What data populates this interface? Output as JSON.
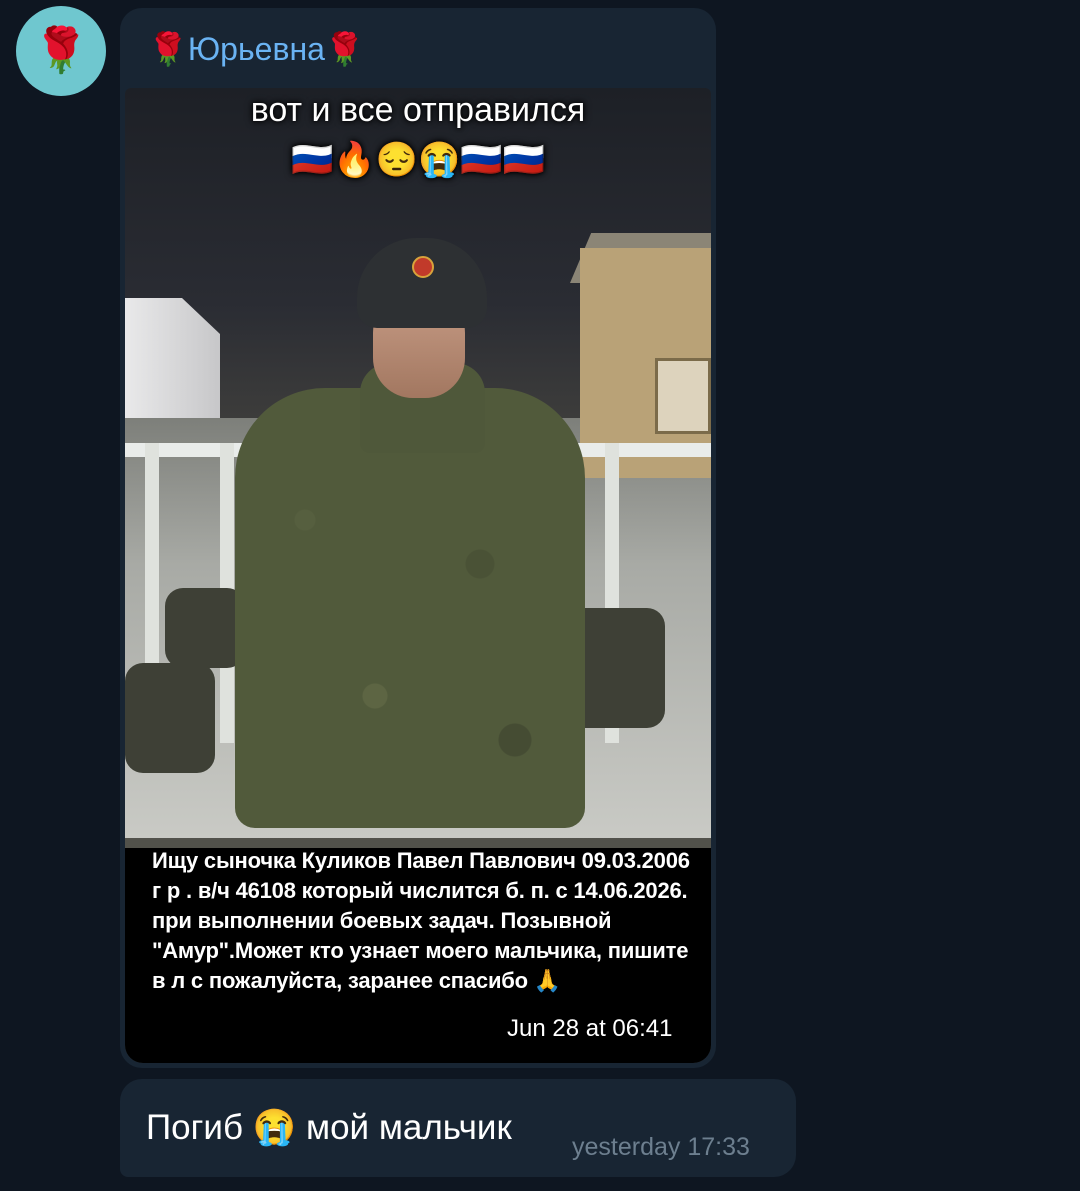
{
  "chat": {
    "avatar_emoji": "🌹",
    "sender_name": "🌹Юрьевна🌹",
    "media_message": {
      "overlay_title": "вот и все отправился",
      "overlay_emoji": "🇷🇺🔥😔😭🇷🇺🇷🇺",
      "caption": "Ищу сыночка Куликов Павел Павлович 09.03.2006 г р . в/ч 46108 который числится б. п.  с 14.06.2026. при выполнении боевых задач. Позывной \"Амур\".Может кто узнает моего мальчика, пишите в л с пожалуйста, заранее спасибо 🙏",
      "time": "Jun 28 at 06:41"
    },
    "text_message": {
      "text": "Погиб 😭 мой мальчик",
      "time": "yesterday 17:33"
    },
    "colors": {
      "background": "#0e1621",
      "bubble": "#182533",
      "sender": "#6ab3f3",
      "time": "#6d7f8f",
      "avatar": "#6fc7cf"
    }
  }
}
